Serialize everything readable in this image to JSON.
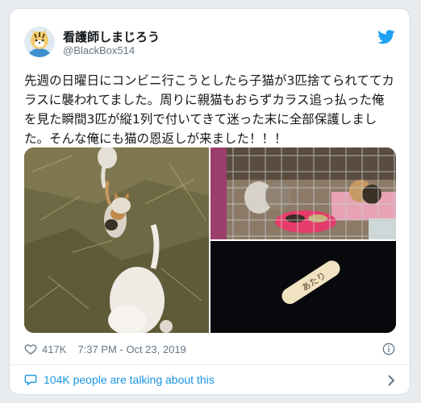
{
  "tweet": {
    "display_name": "看護師しまじろう",
    "handle": "@BlackBox514",
    "text": "先週の日曜日にコンビニ行こうとしたら子猫が3匹捨てられててカラスに襲われてました。周りに親猫もおらずカラス追っ払った俺を見た瞬間3匹が縦1列で付いてきて迷った末に全部保護しました。そんな俺にも猫の恩返しが来ました！！！",
    "likes": "417K",
    "timestamp": "7:37 PM - Oct 23, 2019",
    "talking": "104K people are talking about this",
    "stick_text": "あたり"
  },
  "icons": {
    "brand": "twitter-bird-icon",
    "like": "heart-icon",
    "info": "info-icon",
    "talk": "speech-bubble-icon",
    "chevron": "chevron-right-icon"
  },
  "colors": {
    "accent": "#1da1f2",
    "link": "#1b95e0",
    "text": "#14171a",
    "muted": "#657786"
  }
}
